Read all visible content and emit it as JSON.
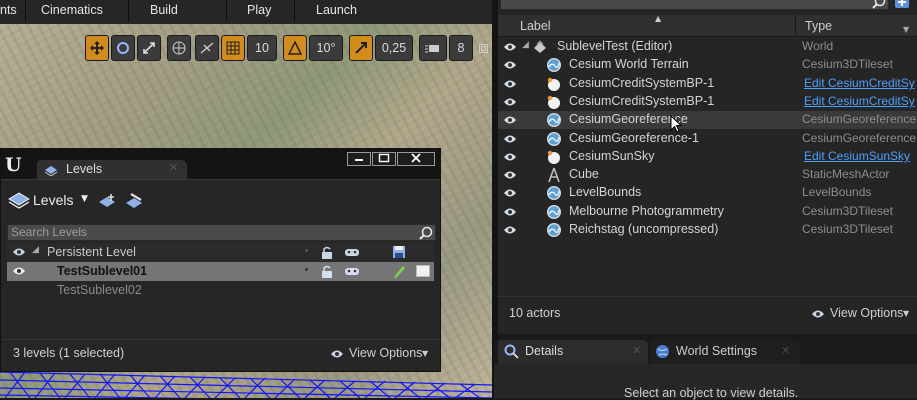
{
  "toolbar": {
    "items": [
      "nts",
      "Cinematics",
      "Build",
      "Play",
      "Launch"
    ]
  },
  "viewport_tools": {
    "grid_snap": "10",
    "rot_snap": "10°",
    "scale_snap": "0,25",
    "cam_speed": "8"
  },
  "levels": {
    "tab_label": "Levels",
    "menu_label": "Levels",
    "search_placeholder": "Search Levels",
    "rows": [
      {
        "name": "Persistent Level"
      },
      {
        "name": "TestSublevel01"
      },
      {
        "name": "TestSublevel02"
      }
    ],
    "status": "3 levels (1 selected)",
    "view_options": "View Options"
  },
  "outliner": {
    "col_label": "Label",
    "col_type": "Type",
    "rows": [
      {
        "name": "SublevelTest (Editor)",
        "type": "World",
        "icon": "world-icon",
        "link": false
      },
      {
        "name": "Cesium World Terrain",
        "type": "Cesium3DTileset",
        "icon": "tileset-icon",
        "link": false
      },
      {
        "name": "CesiumCreditSystemBP-1",
        "type": "Edit CesiumCreditSy",
        "icon": "blueprint-icon",
        "link": true
      },
      {
        "name": "CesiumCreditSystemBP-1",
        "type": "Edit CesiumCreditSy",
        "icon": "blueprint-icon",
        "link": true
      },
      {
        "name": "CesiumGeoreference",
        "type": "CesiumGeoreference",
        "icon": "georef-icon",
        "link": false
      },
      {
        "name": "CesiumGeoreference-1",
        "type": "CesiumGeoreference",
        "icon": "georef-icon",
        "link": false
      },
      {
        "name": "CesiumSunSky",
        "type": "Edit CesiumSunSky",
        "icon": "blueprint-icon",
        "link": true
      },
      {
        "name": "Cube",
        "type": "StaticMeshActor",
        "icon": "mesh-icon",
        "link": false
      },
      {
        "name": "LevelBounds",
        "type": "LevelBounds",
        "icon": "bounds-icon",
        "link": false
      },
      {
        "name": "Melbourne Photogrammetry",
        "type": "Cesium3DTileset",
        "icon": "tileset-icon",
        "link": false
      },
      {
        "name": "Reichstag (uncompressed)",
        "type": "Cesium3DTileset",
        "icon": "tileset-icon",
        "link": false
      }
    ],
    "status": "10 actors",
    "view_options": "View Options"
  },
  "details": {
    "tab1": "Details",
    "tab2": "World Settings",
    "placeholder": "Select an object to view details."
  }
}
